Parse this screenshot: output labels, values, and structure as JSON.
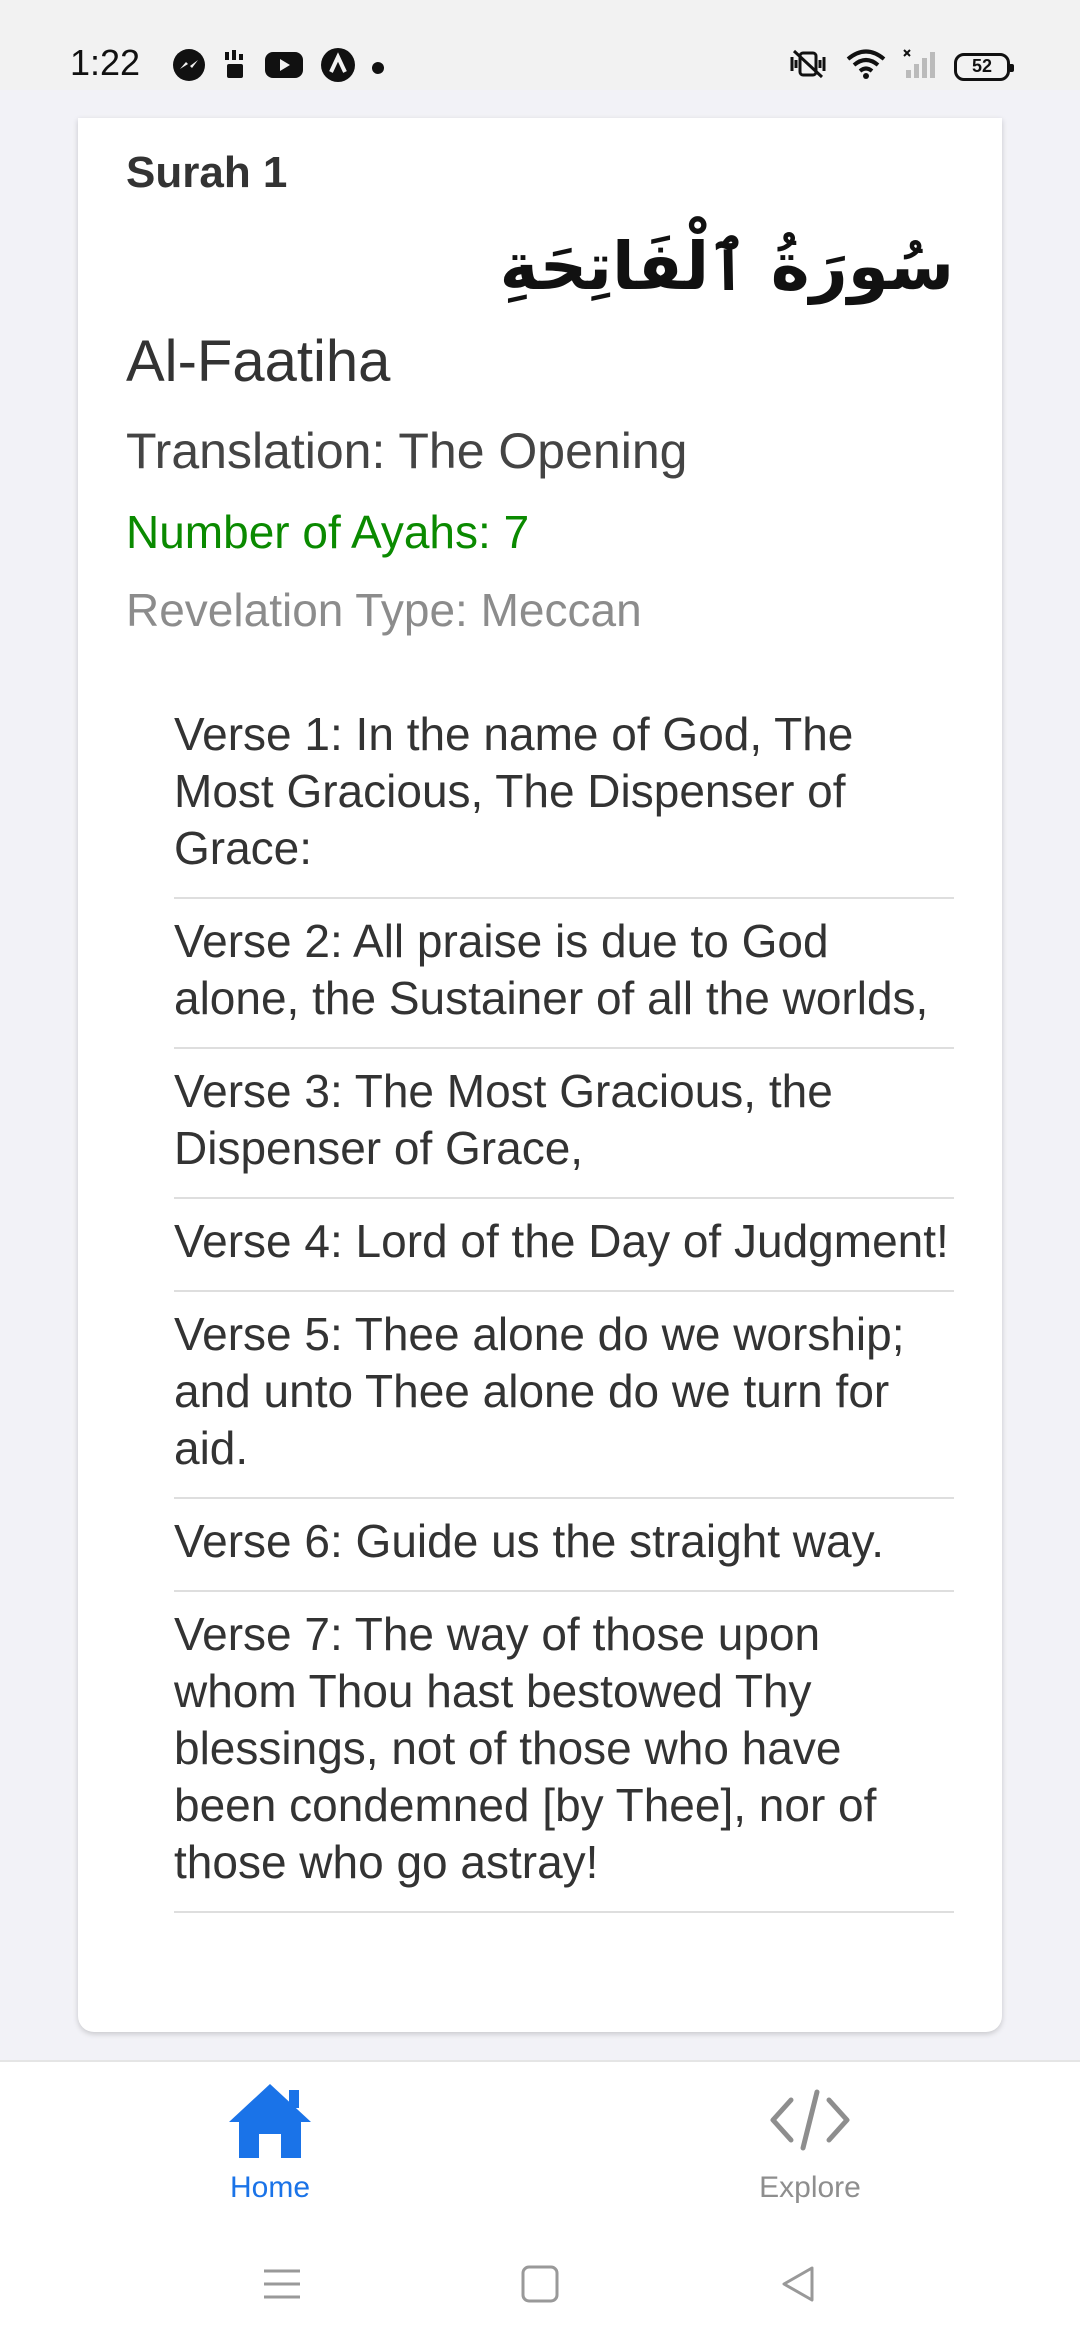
{
  "status_bar": {
    "time": "1:22",
    "battery": "52",
    "left_icons": [
      "messenger-icon",
      "sim-icon",
      "youtube-icon",
      "app-a-icon",
      "notification-dot"
    ],
    "right_icons": [
      "vibrate-off-icon",
      "wifi-icon",
      "signal-icon",
      "battery-icon"
    ]
  },
  "surah": {
    "number_label": "Surah 1",
    "arabic_name": "سُورَةُ ٱلْفَاتِحَةِ",
    "english_name": "Al-Faatiha",
    "translation": "Translation: The Opening",
    "ayah_count": "Number of Ayahs: 7",
    "revelation_type": "Revelation Type: Meccan"
  },
  "verses": [
    "Verse 1: In the name of God, The Most Gracious, The Dispenser of Grace:",
    "Verse 2: All praise is due to God alone, the Sustainer of all the worlds,",
    "Verse 3: The Most Gracious, the Dispenser of Grace,",
    "Verse 4: Lord of the Day of Judgment!",
    "Verse 5: Thee alone do we worship; and unto Thee alone do we turn for aid.",
    "Verse 6: Guide us the straight way.",
    "Verse 7: The way of those upon whom Thou hast bestowed Thy blessings, not of those who have been condemned [by Thee], nor of those who go astray!"
  ],
  "bottom_nav": {
    "home_label": "Home",
    "explore_label": "Explore",
    "home_icon": "home-icon",
    "explore_icon": "code-icon"
  },
  "colors": {
    "accent": "#1a73e8",
    "ayah_green": "#0a8a00",
    "muted_gray": "#8c8c8c"
  }
}
